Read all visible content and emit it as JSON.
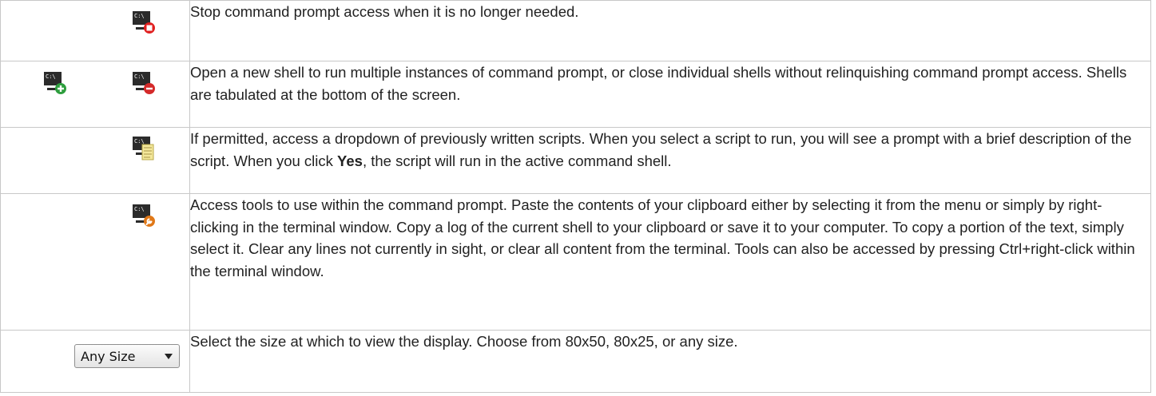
{
  "rows": [
    {
      "icons": [
        "command-prompt-stop-icon"
      ],
      "text": "Stop command prompt access when it is no longer needed."
    },
    {
      "icons": [
        "command-prompt-add-shell-icon",
        "command-prompt-close-shell-icon"
      ],
      "text": "Open a new shell to run multiple instances of command prompt, or close individual shells without relinquishing command prompt access. Shells are tabulated at the bottom of the screen."
    },
    {
      "icons": [
        "command-prompt-scripts-icon"
      ],
      "text_before": "If permitted, access a dropdown of previously written scripts. When you select a script to run, you will see a prompt with a brief description of the script. When you click ",
      "text_bold": "Yes",
      "text_after": ", the script will run in the active command shell."
    },
    {
      "icons": [
        "command-prompt-tools-icon"
      ],
      "text": "Access tools to use within the command prompt. Paste the contents of your clipboard either by selecting it from the menu or simply by right-clicking in the terminal window. Copy a log of the current shell to your clipboard or save it to your computer. To copy a portion of the text, simply select it. Clear any lines not currently in sight, or clear all content from the terminal. Tools can also be accessed by pressing Ctrl+right-click within the terminal window."
    },
    {
      "dropdown": {
        "value": "Any Size",
        "icon": "chevron-down-icon"
      },
      "text": "Select the size at which to view the display. Choose from 80x50, 80x25, or any size."
    }
  ],
  "icon_label": "C:\\",
  "colors": {
    "stop": "#e02020",
    "add": "#2e9e3e",
    "close": "#d42a2a",
    "tools": "#e07818",
    "notepad": "#f3e79a"
  }
}
